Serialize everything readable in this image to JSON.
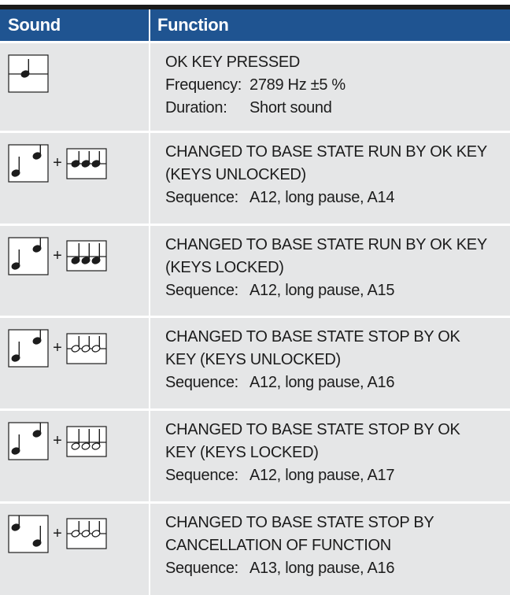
{
  "header": {
    "col1": "Sound",
    "col2": "Function"
  },
  "rows": [
    {
      "sound": {
        "left": "note-line",
        "right": null
      },
      "title": [
        "OK KEY PRESSED"
      ],
      "details": [
        {
          "key": "Frequency:",
          "value": "2789 Hz ±5 %"
        },
        {
          "key": "Duration:",
          "value": "Short sound"
        }
      ]
    },
    {
      "sound": {
        "left": "notes-low-high",
        "right": "three-filled-top"
      },
      "title": [
        "CHANGED TO BASE STATE RUN BY OK KEY",
        "(KEYS UNLOCKED)"
      ],
      "details": [
        {
          "key": "Sequence:",
          "value": "A12, long pause, A14"
        }
      ]
    },
    {
      "sound": {
        "left": "notes-low-high",
        "right": "three-filled-bottom"
      },
      "title": [
        "CHANGED TO BASE STATE RUN BY OK KEY",
        "(KEYS LOCKED)"
      ],
      "details": [
        {
          "key": "Sequence:",
          "value": "A12, long pause, A15"
        }
      ]
    },
    {
      "sound": {
        "left": "notes-low-high",
        "right": "three-hollow-middle"
      },
      "title": [
        "CHANGED TO BASE STATE STOP BY OK",
        "KEY (KEYS UNLOCKED)"
      ],
      "details": [
        {
          "key": "Sequence:",
          "value": "A12, long pause, A16"
        }
      ]
    },
    {
      "sound": {
        "left": "notes-low-high",
        "right": "three-hollow-bottom"
      },
      "title": [
        "CHANGED TO BASE STATE STOP BY OK",
        "KEY (KEYS LOCKED)"
      ],
      "details": [
        {
          "key": "Sequence:",
          "value": "A12, long pause, A17"
        }
      ]
    },
    {
      "sound": {
        "left": "notes-high-low",
        "right": "three-hollow-middle"
      },
      "title": [
        "CHANGED TO BASE STATE STOP BY",
        "CANCELLATION OF FUNCTION"
      ],
      "details": [
        {
          "key": "Sequence:",
          "value": "A13, long pause, A16"
        }
      ]
    }
  ],
  "plus_sign": "+",
  "colors": {
    "header_bg": "#1f5491",
    "row_bg": "#e5e6e7",
    "text": "#1c1c1c",
    "top_rule": "#1a1a1a"
  }
}
